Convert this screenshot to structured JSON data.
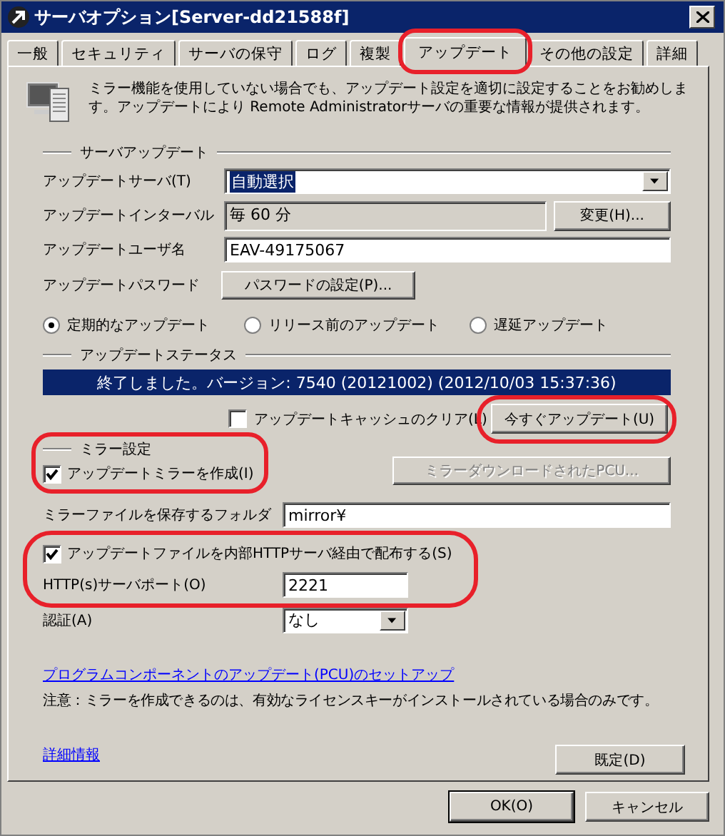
{
  "window": {
    "title": "サーバオプション[Server-dd21588f]"
  },
  "tabs": [
    {
      "label": "一般",
      "selected": false
    },
    {
      "label": "セキュリティ",
      "selected": false
    },
    {
      "label": "サーバの保守",
      "selected": false
    },
    {
      "label": "ログ",
      "selected": false
    },
    {
      "label": "複製",
      "selected": false
    },
    {
      "label": "アップデート",
      "selected": true
    },
    {
      "label": "その他の設定",
      "selected": false
    },
    {
      "label": "詳細",
      "selected": false
    }
  ],
  "description": "ミラー機能を使用していない場合でも、アップデート設定を適切に設定することをお勧めします。アップデートにより Remote Administratorサーバの重要な情報が提供されます。",
  "server_update": {
    "title": "サーバアップデート",
    "fields": [
      {
        "kind": "dropdown",
        "label": "アップデートサーバ(T)",
        "value": "自動選択"
      },
      {
        "kind": "readonly",
        "label": "アップデートインターバル",
        "value": "毎 60 分",
        "button": "変更(H)..."
      },
      {
        "kind": "text",
        "label": "アップデートユーザ名",
        "value": "EAV-49175067"
      },
      {
        "kind": "button",
        "label": "アップデートパスワード",
        "button": "パスワードの設定(P)..."
      }
    ],
    "radios": [
      {
        "label": "定期的なアップデート",
        "selected": true
      },
      {
        "label": "リリース前のアップデート",
        "selected": false
      },
      {
        "label": "遅延アップデート",
        "selected": false
      }
    ]
  },
  "update_status": {
    "title": "アップデートステータス",
    "message": "終了しました。バージョン: 7540 (20121002)  (2012/10/03 15:37:36)",
    "clear_cache": {
      "label": "アップデートキャッシュのクリア(L)",
      "checked": false
    },
    "update_now": "今すぐアップデート(U)"
  },
  "mirror": {
    "title": "ミラー設定",
    "create_mirror": {
      "label": "アップデートミラーを作成(I)",
      "checked": true
    },
    "download_button": {
      "label": "ミラーダウンロードされたPCU...",
      "disabled": true
    },
    "folder": {
      "label": "ミラーファイルを保存するフォルダ",
      "value": "mirror¥"
    },
    "http": {
      "label": "アップデートファイルを内部HTTPサーバ経由で配布する(S)",
      "checked": true
    },
    "port": {
      "label": "HTTP(s)サーバポート(O)",
      "value": "2221"
    },
    "auth": {
      "label": "認証(A)",
      "value": "なし"
    }
  },
  "pcu_link": "プログラムコンポーネントのアップデート(PCU)のセットアップ",
  "note": "注意：ミラーを作成できるのは、有効なライセンスキーがインストールされている場合のみです。",
  "details_link": "詳細情報",
  "default_button": "既定(D)",
  "buttons": [
    "OK(O)",
    "キャンセル"
  ]
}
